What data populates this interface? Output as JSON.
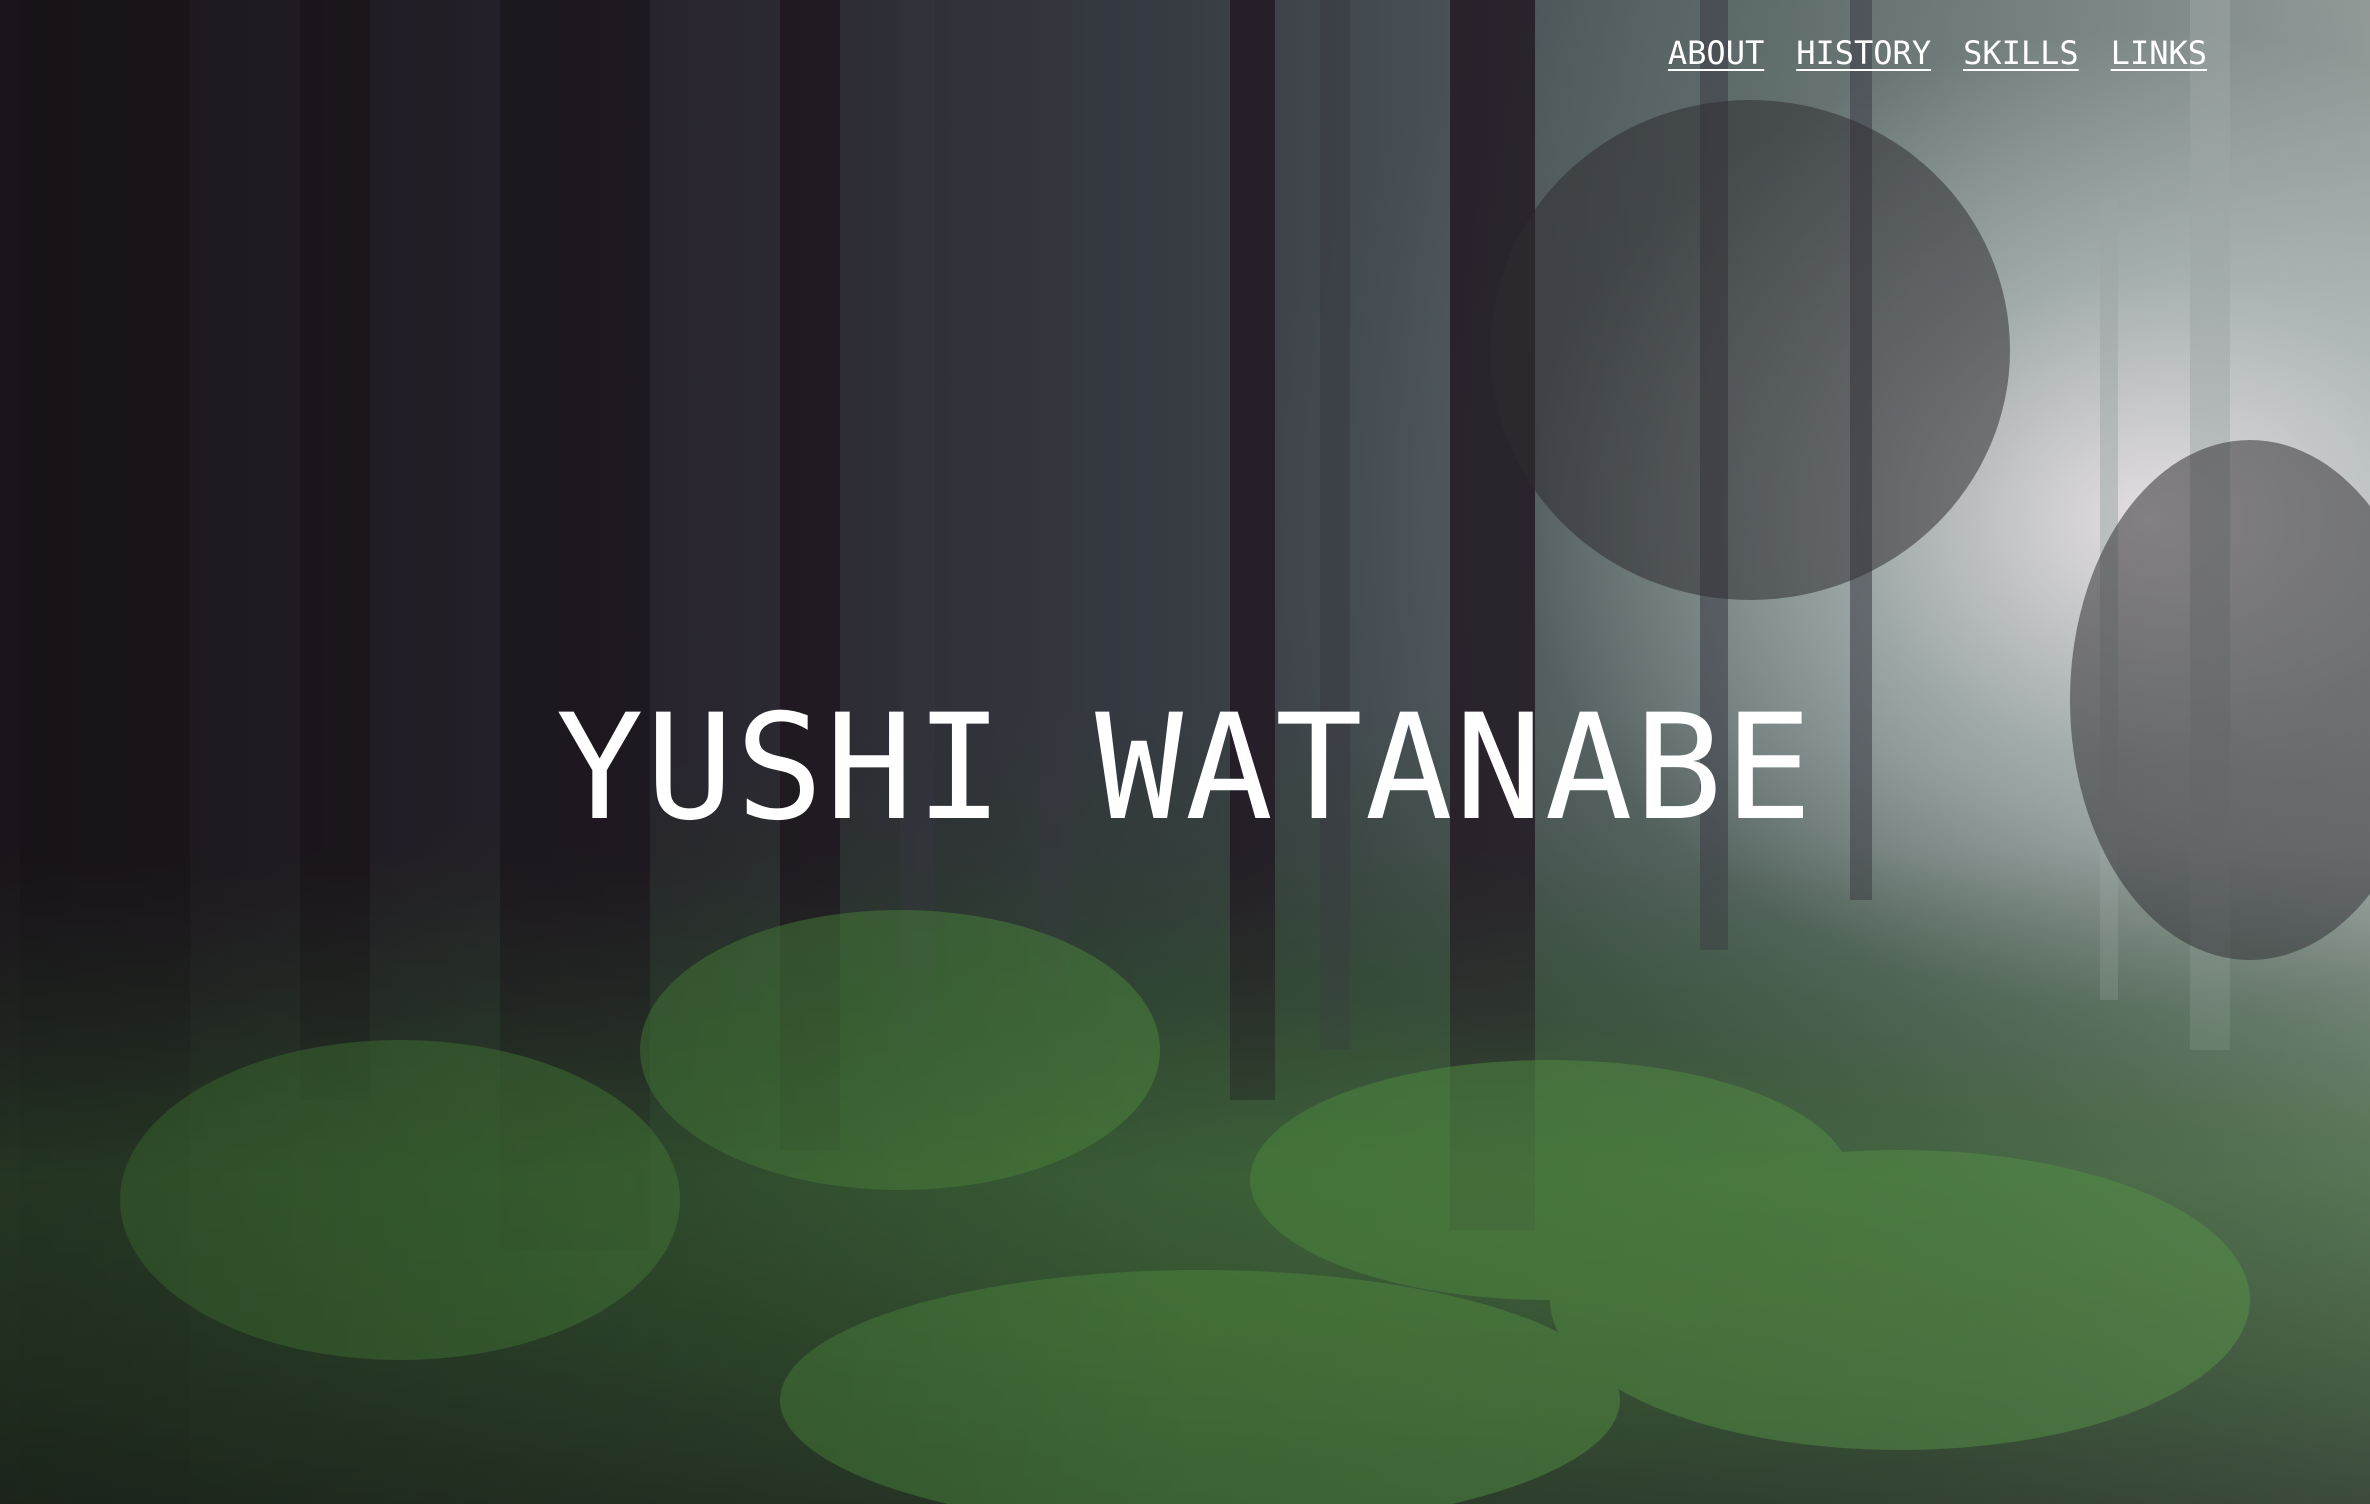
{
  "nav": {
    "items": [
      {
        "label": "ABOUT"
      },
      {
        "label": "HISTORY"
      },
      {
        "label": "SKILLS"
      },
      {
        "label": "LINKS"
      }
    ]
  },
  "hero": {
    "title": "YUSHI WATANABE",
    "background_description_colors": {
      "dark": "#2a1f2a",
      "foliage": "#4a7a3e",
      "light": "#e8e2e6"
    }
  }
}
